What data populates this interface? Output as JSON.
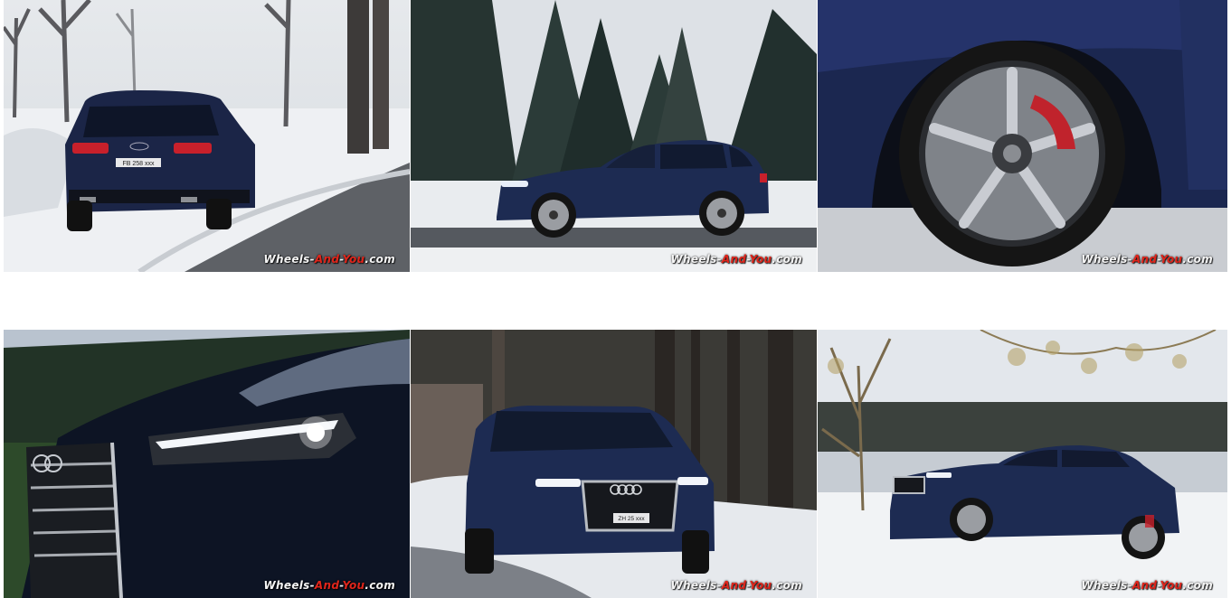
{
  "gallery": {
    "watermark": {
      "prefix": "Wheels-",
      "accent": "And",
      "mid": "-",
      "accent2": "You",
      "suffix": ".com"
    },
    "accent_color": "#e0251b",
    "car_color": "#1d2b52",
    "plate_rear": "FB 258 xxx",
    "plate_front": "ZH 25 xxx"
  }
}
